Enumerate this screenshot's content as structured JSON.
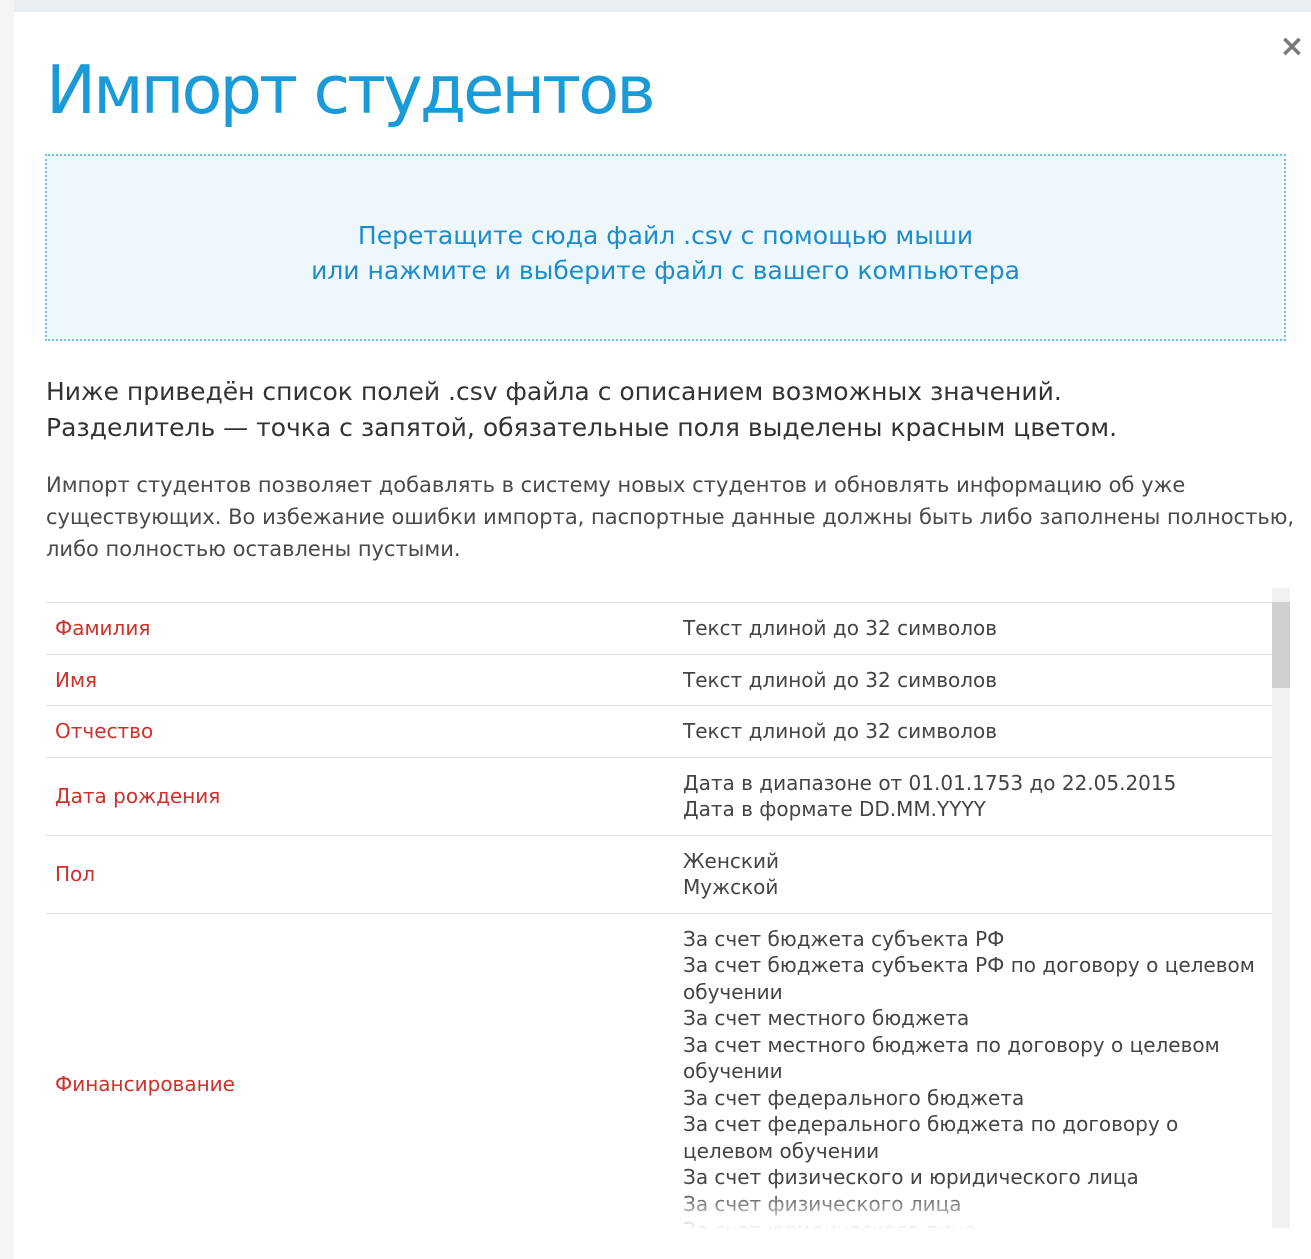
{
  "modal": {
    "title": "Импорт студентов",
    "close_label": "×"
  },
  "dropzone": {
    "line1": "Перетащите сюда файл .csv с помощью мыши",
    "line2": "или нажмите и выберите файл с вашего компьютера"
  },
  "intro": {
    "line1": "Ниже приведён список полей .csv файла с описанием возможных значений.",
    "line2": "Разделитель — точка с запятой, обязательные поля выделены красным цветом."
  },
  "note": "Импорт студентов позволяет добавлять в систему новых студентов и обновлять информацию об уже существующих. Во избежание ошибки импорта, паспортные данные должны быть либо заполнены полностью, либо полностью оставлены пустыми.",
  "fields": [
    {
      "name": "Фамилия",
      "lines": [
        "Текст длиной до 32 символов"
      ]
    },
    {
      "name": "Имя",
      "lines": [
        "Текст длиной до 32 символов"
      ]
    },
    {
      "name": "Отчество",
      "lines": [
        "Текст длиной до 32 символов"
      ]
    },
    {
      "name": "Дата рождения",
      "lines": [
        "Дата в диапазоне от 01.01.1753 до 22.05.2015",
        "Дата в формате DD.MM.YYYY"
      ]
    },
    {
      "name": "Пол",
      "lines": [
        "Женский",
        "Мужской"
      ]
    },
    {
      "name": "Финансирование",
      "lines": [
        "За счет бюджета субъекта РФ",
        "За счет бюджета субъекта РФ по договору о целевом обучении",
        "За счет местного бюджета",
        "За счет местного бюджета по договору о целевом обучении",
        "За счет федерального бюджета",
        "За счет федерального бюджета по договору о целевом обучении",
        "За счет физического и юридического лица",
        "За счет физического лица",
        "За счет юридического лица"
      ]
    }
  ]
}
